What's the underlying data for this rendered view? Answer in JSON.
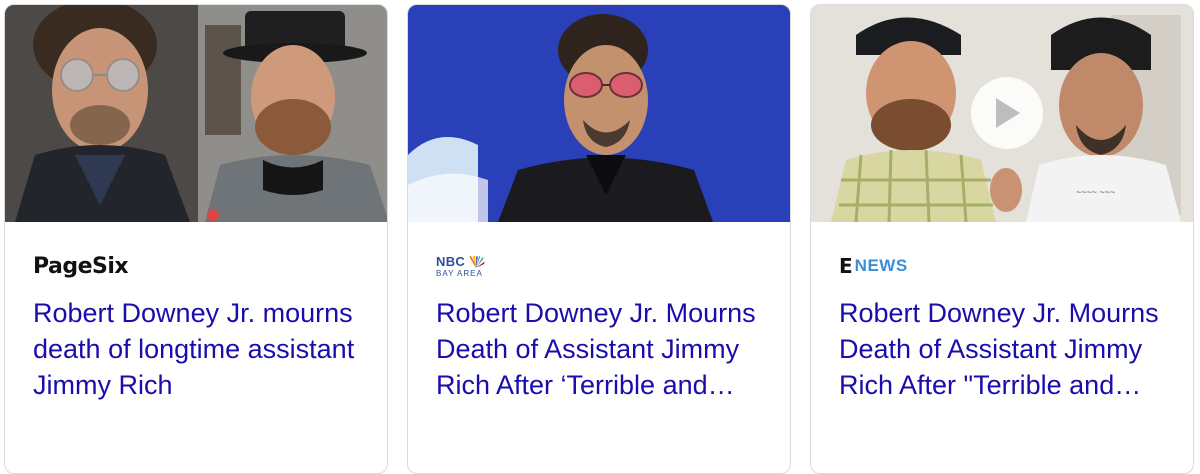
{
  "cards": [
    {
      "source": "PageSix",
      "headline": "Robert Downey Jr. mourns death of longtime assistant Jimmy Rich",
      "thumbnail_icon": "photo-two-men"
    },
    {
      "source": "NBC",
      "source_sub": "BAY AREA",
      "headline": "Robert Downey Jr. Mourns Death of Assistant Jimmy Rich After ‘Terrible and…",
      "thumbnail_icon": "photo-man-red-glasses"
    },
    {
      "source_e": "E",
      "source": "NEWS",
      "headline": "Robert Downey Jr. Mourns Death of Assistant Jimmy Rich After \"Terrible and…",
      "thumbnail_icon": "video-two-men",
      "play_icon": "play-icon"
    }
  ],
  "colors": {
    "headline_link": "#1a0dab",
    "card_border": "#dadce0",
    "nbc_blue": "#2a4f9f",
    "enews_blue": "#3b8ed6"
  }
}
